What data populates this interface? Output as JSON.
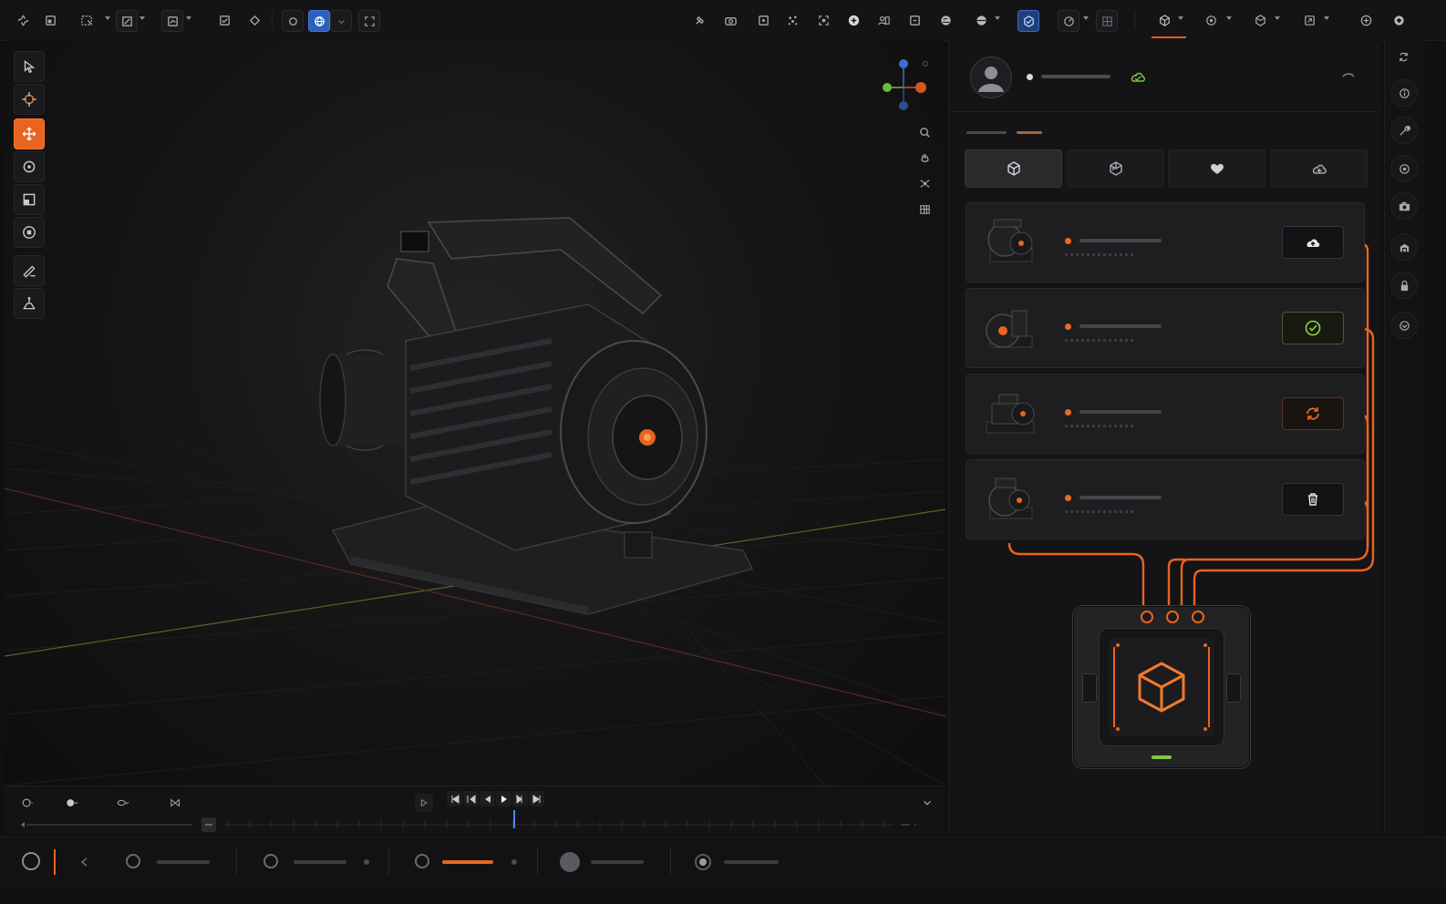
{
  "colors": {
    "accent": "#e8641f",
    "selection_blue": "#2f5fb8",
    "success_green": "#7ec843",
    "panel_bg": "#141416",
    "card_bg": "#1e1e21"
  },
  "toolbar": {
    "left_icons": [
      "nav-icon",
      "frame-icon",
      "select-icon",
      "transform-icon",
      "snap-icon",
      "check-icon",
      "shape-icon",
      "cursor-icon",
      "globe-icon",
      "fullscreen-icon"
    ],
    "right_icons": [
      "pin-icon",
      "camera-icon",
      "object-icon",
      "scatter-icon",
      "focus-icon",
      "add-icon",
      "users-icon",
      "layer-icon",
      "web-icon",
      "globe2-icon",
      "model-icon",
      "render-icon",
      "grid-icon",
      "cube-icon",
      "target-icon",
      "box-icon",
      "export-icon",
      "package-icon",
      "blender-icon"
    ]
  },
  "tools": {
    "left": [
      "select-tool",
      "cursor-tool",
      "move-tool",
      "rotate-tool",
      "scale-tool",
      "transform-tool",
      "annotate-tool",
      "measure-tool"
    ],
    "active": "move-tool",
    "view": [
      "zoom-icon",
      "pan-hand-icon",
      "orbit-icon",
      "grid-view-icon"
    ]
  },
  "panel": {
    "user": {
      "status": "online",
      "cloud_state": "synced"
    },
    "tabs": [
      {
        "icon": "cube-icon",
        "active": true
      },
      {
        "icon": "box-icon",
        "active": false
      },
      {
        "icon": "heart-icon",
        "active": false
      },
      {
        "icon": "cloud-icon",
        "active": false
      }
    ],
    "assets": [
      {
        "action": "cloud-upload-icon",
        "action_state": "upload"
      },
      {
        "action": "check-circle-icon",
        "action_state": "done"
      },
      {
        "action": "sync-icon",
        "action_state": "syncing"
      },
      {
        "action": "trash-icon",
        "action_state": "delete"
      }
    ],
    "hub": {
      "icon": "cube-outline-icon",
      "status": "ok"
    }
  },
  "timeline": {
    "playhead": 0.43,
    "controls": [
      "jump-start",
      "prev-key",
      "prev-frame",
      "play",
      "next-frame",
      "jump-end"
    ]
  },
  "statusbar": {
    "items": [
      {
        "icon": "search-icon"
      },
      {
        "icon": "back-icon"
      },
      {
        "icon": "circle-icon",
        "progress": 0
      },
      {
        "icon": "circle-icon",
        "progress": 0
      },
      {
        "icon": "circle-icon",
        "progress": 1,
        "highlight": true
      },
      {
        "icon": "circle-filled-icon",
        "progress": 0
      },
      {
        "icon": "circle-dot-icon",
        "progress": 0
      }
    ]
  },
  "right_strip": [
    "sync-icon",
    "info-icon",
    "wrench-icon",
    "world-icon",
    "camera-icon",
    "materials-icon",
    "lock-icon",
    "constraint-icon"
  ]
}
